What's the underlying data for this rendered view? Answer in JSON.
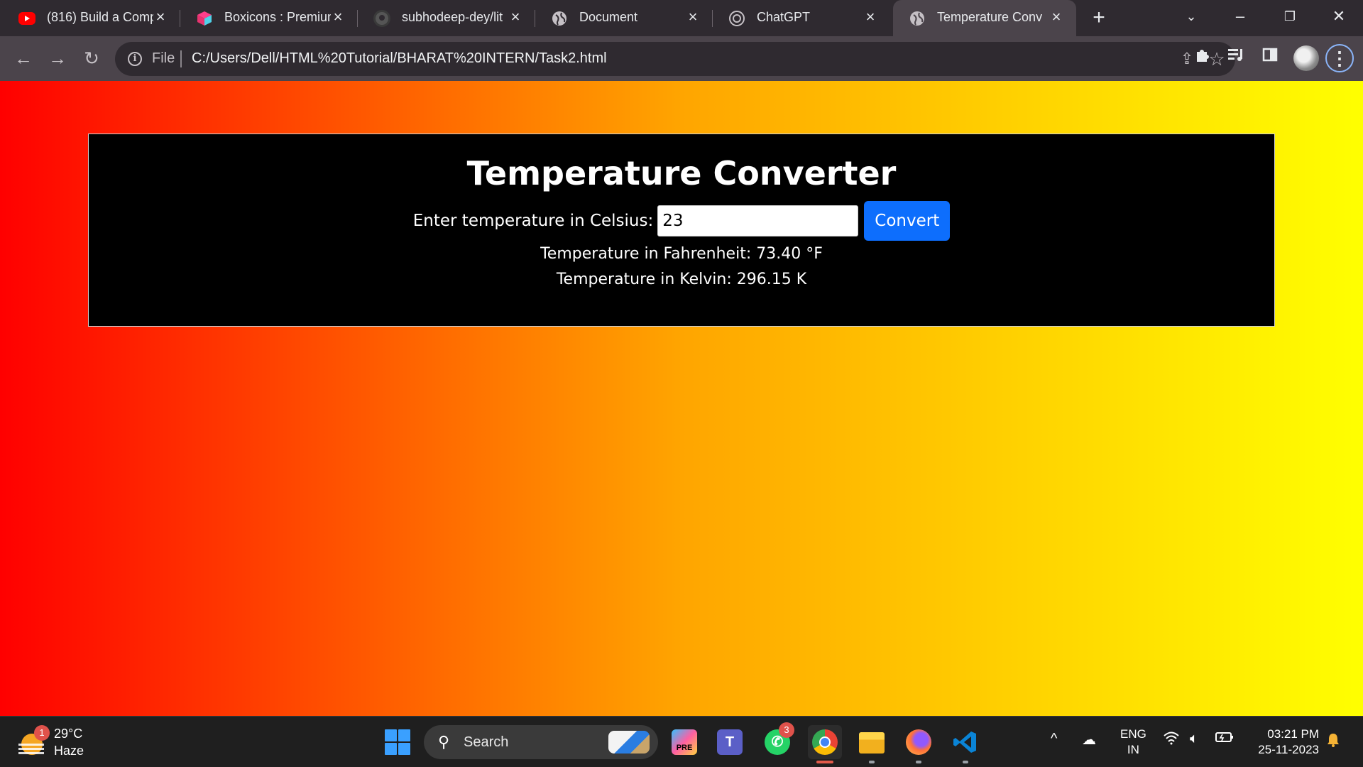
{
  "browser": {
    "tabs": [
      {
        "title": "(816) Build a Comp",
        "icon": "youtube-icon",
        "active": false
      },
      {
        "title": "Boxicons : Premium",
        "icon": "boxicons-icon",
        "active": false
      },
      {
        "title": "subhodeep-dey/lit",
        "icon": "github-icon",
        "active": false
      },
      {
        "title": "Document",
        "icon": "globe-icon",
        "active": false
      },
      {
        "title": "ChatGPT",
        "icon": "chatgpt-icon",
        "active": false
      },
      {
        "title": "Temperature Conv",
        "icon": "globe-icon",
        "active": true
      }
    ],
    "address": {
      "scheme_label": "File",
      "url": "C:/Users/Dell/HTML%20Tutorial/BHARAT%20INTERN/Task2.html"
    }
  },
  "page": {
    "heading": "Temperature Converter",
    "input_label": "Enter temperature in Celsius:",
    "input_value": "23",
    "button_label": "Convert",
    "fahrenheit_result": "Temperature in Fahrenheit: 73.40 °F",
    "kelvin_result": "Temperature in Kelvin: 296.15 K",
    "colors": {
      "gradient_start": "#ff0000",
      "gradient_mid": "#ffa500",
      "gradient_end": "#ffff00",
      "card": "#000000",
      "button": "#0d6efd"
    }
  },
  "taskbar": {
    "weather": {
      "temp": "29°C",
      "desc": "Haze",
      "badge": "1"
    },
    "search_label": "Search",
    "whatsapp_badge": "3",
    "lang_top": "ENG",
    "lang_bottom": "IN",
    "time": "03:21 PM",
    "date": "25-11-2023"
  }
}
